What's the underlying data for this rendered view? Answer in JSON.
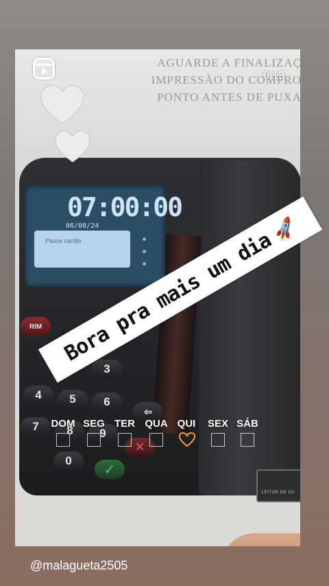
{
  "story": {
    "timer": "0:13",
    "username": "@malagueta2505",
    "banner_text": "Bora pra mais um dia",
    "banner_emoji": "🚀",
    "icons": {
      "reels": "reels-icon",
      "hearts": "heart-sticker-icon"
    }
  },
  "photo": {
    "paper_lines": [
      "AGUARDE A FINALIZAÇ",
      "IMPRESSÃO DO COMPRO",
      "PONTO ANTES DE PUXA"
    ],
    "clock_display": "07:00:00",
    "date_display": "06/08/24",
    "lcd_text": "Passe cartão",
    "keys": {
      "rim": "RIM",
      "three": "3",
      "four": "4",
      "five": "5",
      "six": "6",
      "seven": "7",
      "eight": "8",
      "nine": "9",
      "zero": "0"
    },
    "reader_label": "LEITOR DE CA"
  },
  "week": {
    "days": [
      "DOM",
      "SEG",
      "TER",
      "QUA",
      "QUI",
      "SEX",
      "SÁB"
    ],
    "selected_day": "QUI",
    "heart_color": "#f2a14a"
  }
}
